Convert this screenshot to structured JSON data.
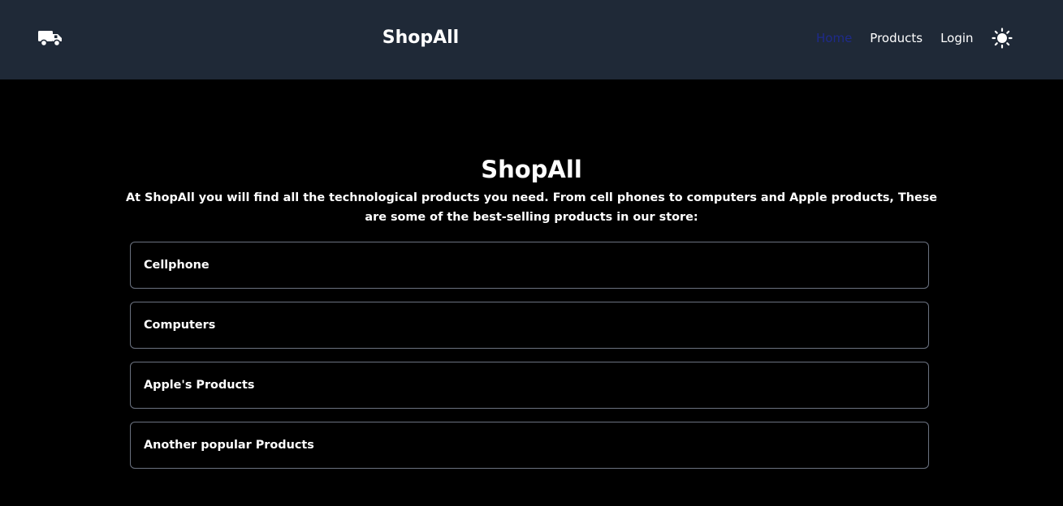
{
  "navbar": {
    "logo_icon": "truck-icon",
    "brand": "ShopAll",
    "links": [
      {
        "label": "Home",
        "active": true
      },
      {
        "label": "Products",
        "active": false
      },
      {
        "label": "Login",
        "active": false
      }
    ],
    "theme_icon": "sun-icon"
  },
  "hero": {
    "title": "ShopAll",
    "description": "At ShopAll you will find all the technological products you need. From cell phones to computers and Apple products, These are some of the best-selling products in our store:"
  },
  "categories": [
    {
      "label": "Cellphone"
    },
    {
      "label": "Computers"
    },
    {
      "label": "Apple's Products"
    },
    {
      "label": "Another popular Products"
    }
  ],
  "colors": {
    "navbar_bg": "#1f2937",
    "page_bg": "#000000",
    "active_link": "#1e2a8a",
    "border": "#6b7280"
  }
}
